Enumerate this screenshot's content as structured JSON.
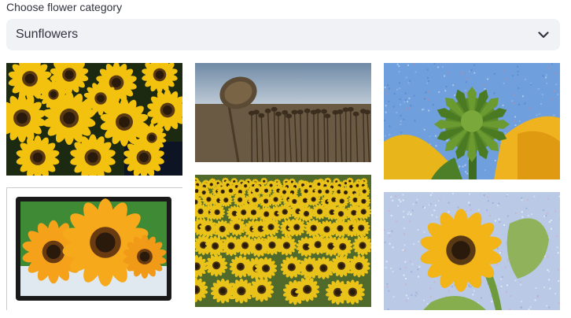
{
  "category_select": {
    "label": "Choose flower category",
    "selected": "Sunflowers"
  },
  "icons": {
    "dropdown": "chevron-down-icon"
  },
  "gallery": [
    {
      "name": "sunflower-bouquet-image",
      "scene": "bouquet"
    },
    {
      "name": "dried-sunflower-field-image",
      "scene": "dried-field"
    },
    {
      "name": "sunflower-bud-sky-image",
      "scene": "bud-sky"
    },
    {
      "name": "framed-sunflowers-image",
      "scene": "framed"
    },
    {
      "name": "sunflower-field-image",
      "scene": "field"
    },
    {
      "name": "single-sunflower-sky-image",
      "scene": "single-sky"
    }
  ],
  "colors": {
    "select_bg": "#f0f2f6",
    "text": "#31333f"
  }
}
